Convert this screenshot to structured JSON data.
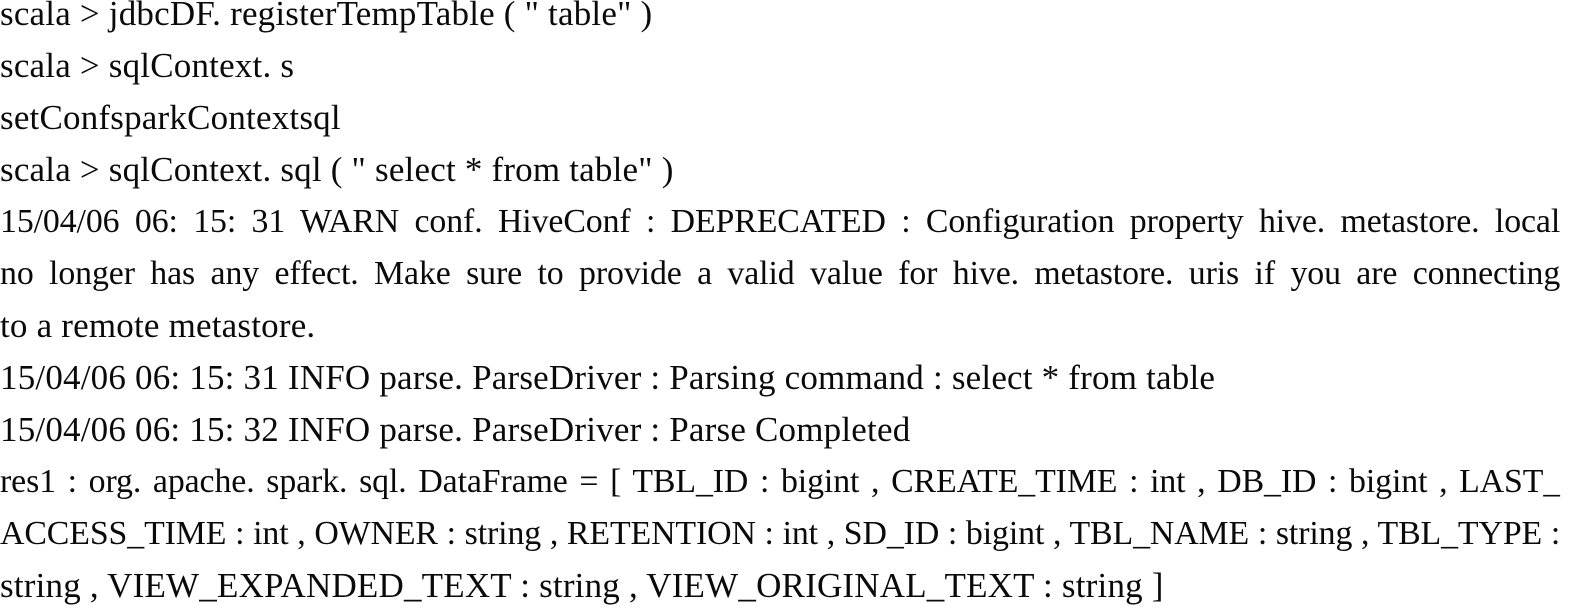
{
  "console": {
    "type": "scala-spark-repl-transcript",
    "background_color": "#ffffff",
    "text_color": "#0a0a0a",
    "prompt": "scala >",
    "line_count": 12,
    "lines": [
      {
        "id": "line-1",
        "kind": "input",
        "text": "scala > jdbcDF. registerTempTable ( \" table\" )"
      },
      {
        "id": "line-2",
        "kind": "input",
        "text": "scala > sqlContext. s"
      },
      {
        "id": "line-3",
        "kind": "completion",
        "text": "setConfsparkContextsql"
      },
      {
        "id": "line-4",
        "kind": "input",
        "text": "scala > sqlContext. sql ( \" select  *  from table\" )"
      },
      {
        "id": "line-5",
        "kind": "log-warn",
        "text": "15/04/06 06: 15: 31  WARN conf. HiveConf : DEPRECATED : Configuration  property  hive. metastore. local"
      },
      {
        "id": "line-6",
        "kind": "log-warn-cont",
        "text": "no  longer  has  any  effect.   Make  sure  to  provide  a  valid  value  for  hive. metastore. uris  if  you  are  connecting"
      },
      {
        "id": "line-7",
        "kind": "log-warn-cont",
        "text": "to  a  remote  metastore."
      },
      {
        "id": "line-8",
        "kind": "log-info",
        "text": "15/04/06 06: 15: 31  INFO parse. ParseDriver : Parsing  command : select  *  from  table"
      },
      {
        "id": "line-9",
        "kind": "log-info",
        "text": "15/04/06 06: 15: 32  INFO parse. ParseDriver : Parse Completed"
      },
      {
        "id": "line-10",
        "kind": "result",
        "text": "res1 : org. apache. spark. sql. DataFrame = [ TBL_ID : bigint , CREATE_TIME : int , DB_ID : bigint , LAST_"
      },
      {
        "id": "line-11",
        "kind": "result-cont",
        "text": "ACCESS_TIME : int , OWNER : string , RETENTION : int , SD_ID : bigint , TBL_NAME : string , TBL_TYPE :"
      },
      {
        "id": "line-12",
        "kind": "result-cont",
        "text": "string , VIEW_EXPANDED_TEXT : string , VIEW_ORIGINAL_TEXT : string ]"
      }
    ]
  },
  "commands": {
    "register_temp_table": "jdbcDF. registerTempTable ( \" table\" )",
    "table_name": "table",
    "sql_context_partial": "sqlContext. s",
    "tab_completions": "setConfsparkContextsql",
    "sql_query": "select  *  from table",
    "sql_call": "sqlContext. sql ( \" select  *  from table\" )"
  },
  "log_entries": [
    {
      "timestamp": "15/04/06 06: 15: 31",
      "level": "WARN",
      "logger": "conf. HiveConf",
      "message": "DEPRECATED : Configuration property hive. metastore. local no longer has any effect. Make sure to provide a valid value for hive. metastore. uris if you are connecting to a remote metastore."
    },
    {
      "timestamp": "15/04/06 06: 15: 31",
      "level": "INFO",
      "logger": "parse. ParseDriver",
      "message": "Parsing command : select  *  from  table"
    },
    {
      "timestamp": "15/04/06 06: 15: 32",
      "level": "INFO",
      "logger": "parse. ParseDriver",
      "message": "Parse Completed"
    }
  ],
  "result": {
    "variable": "res1",
    "type": "org. apache. spark. sql. DataFrame",
    "schema": [
      {
        "name": "TBL_ID",
        "type": "bigint"
      },
      {
        "name": "CREATE_TIME",
        "type": "int"
      },
      {
        "name": "DB_ID",
        "type": "bigint"
      },
      {
        "name": "LAST_ACCESS_TIME",
        "type": "int"
      },
      {
        "name": "OWNER",
        "type": "string"
      },
      {
        "name": "RETENTION",
        "type": "int"
      },
      {
        "name": "SD_ID",
        "type": "bigint"
      },
      {
        "name": "TBL_NAME",
        "type": "string"
      },
      {
        "name": "TBL_TYPE",
        "type": "string"
      },
      {
        "name": "VIEW_EXPANDED_TEXT",
        "type": "string"
      },
      {
        "name": "VIEW_ORIGINAL_TEXT",
        "type": "string"
      }
    ]
  }
}
